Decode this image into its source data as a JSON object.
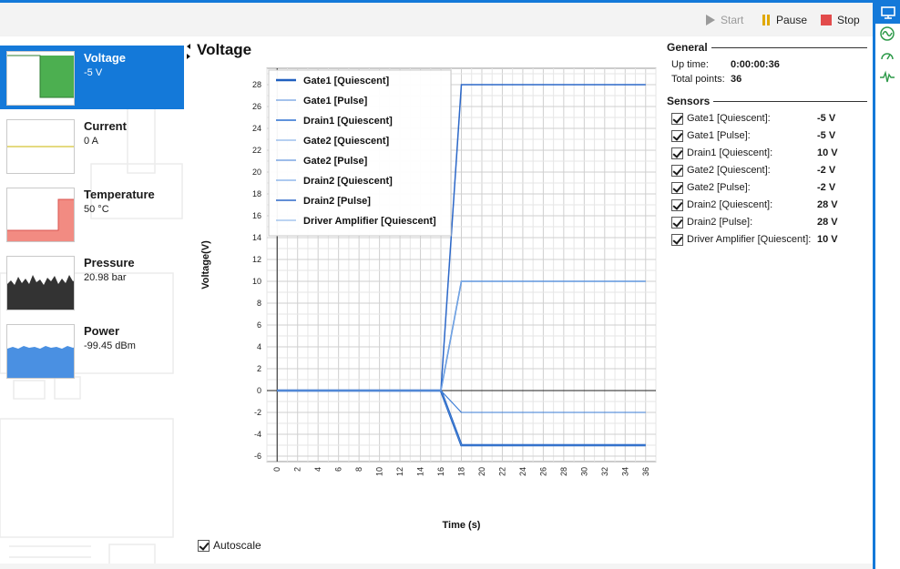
{
  "toolbar": {
    "start_label": "Start",
    "pause_label": "Pause",
    "stop_label": "Stop"
  },
  "sensors": [
    {
      "name": "Voltage",
      "value": "-5 V",
      "active": true,
      "thumb_color": "#4caf50"
    },
    {
      "name": "Current",
      "value": "0 A",
      "active": false,
      "thumb_color": "#c8b400"
    },
    {
      "name": "Temperature",
      "value": "50 °C",
      "active": false,
      "thumb_color": "#f28b82"
    },
    {
      "name": "Pressure",
      "value": "20.98 bar",
      "active": false,
      "thumb_color": "#333333"
    },
    {
      "name": "Power",
      "value": "-99.45 dBm",
      "active": false,
      "thumb_color": "#4a90e2"
    }
  ],
  "chart": {
    "title": "Voltage",
    "autoscale_label": "Autoscale",
    "autoscale_checked": true
  },
  "chart_data": {
    "type": "line",
    "xlabel": "Time (s)",
    "ylabel": "Voltage(V)",
    "xlim": [
      -1,
      37
    ],
    "ylim": [
      -6.5,
      29.5
    ],
    "xticks": [
      0,
      2,
      4,
      6,
      8,
      10,
      12,
      14,
      16,
      18,
      20,
      22,
      24,
      26,
      28,
      30,
      32,
      34,
      36
    ],
    "yticks": [
      -6,
      -4,
      -2,
      0,
      2,
      4,
      6,
      8,
      10,
      12,
      14,
      16,
      18,
      20,
      22,
      24,
      26,
      28
    ],
    "grid": true,
    "legend": "top-left",
    "series": [
      {
        "name": "Gate1 [Quiescent]",
        "color": "#1f5fbf",
        "width": 2.5,
        "x": [
          0,
          16,
          18,
          36
        ],
        "y": [
          0,
          0,
          -5,
          -5
        ]
      },
      {
        "name": "Gate1 [Pulse]",
        "color": "#4a86d8",
        "width": 1,
        "x": [
          0,
          16,
          18,
          36
        ],
        "y": [
          0,
          0,
          -5,
          -5
        ]
      },
      {
        "name": "Drain1 [Quiescent]",
        "color": "#2a6fd0",
        "width": 1.5,
        "x": [
          0,
          16,
          18,
          36
        ],
        "y": [
          0,
          0,
          10,
          10
        ]
      },
      {
        "name": "Gate2 [Quiescent]",
        "color": "#6fa2e4",
        "width": 1,
        "x": [
          0,
          16,
          18,
          36
        ],
        "y": [
          0,
          0,
          -2,
          -2
        ]
      },
      {
        "name": "Gate2 [Pulse]",
        "color": "#3a7bd5",
        "width": 1,
        "x": [
          0,
          16,
          18,
          36
        ],
        "y": [
          0,
          0,
          -2,
          -2
        ]
      },
      {
        "name": "Drain2 [Quiescent]",
        "color": "#5b95e0",
        "width": 1,
        "x": [
          0,
          16,
          18,
          36
        ],
        "y": [
          0,
          0,
          28,
          28
        ]
      },
      {
        "name": "Drain2 [Pulse]",
        "color": "#2d68c8",
        "width": 1.5,
        "x": [
          0,
          16,
          18,
          36
        ],
        "y": [
          0,
          0,
          28,
          28
        ]
      },
      {
        "name": "Driver Amplifier [Quiescent]",
        "color": "#7aaae6",
        "width": 1,
        "x": [
          0,
          16,
          18,
          36
        ],
        "y": [
          0,
          0,
          10,
          10
        ]
      }
    ]
  },
  "general": {
    "title": "General",
    "uptime_label": "Up time:",
    "uptime_value": "0:00:00:36",
    "points_label": "Total points:",
    "points_value": "36"
  },
  "sensors_panel": {
    "title": "Sensors",
    "items": [
      {
        "label": "Gate1 [Quiescent]:",
        "value": "-5 V",
        "checked": true
      },
      {
        "label": "Gate1 [Pulse]:",
        "value": "-5 V",
        "checked": true
      },
      {
        "label": "Drain1 [Quiescent]:",
        "value": "10 V",
        "checked": true
      },
      {
        "label": "Gate2 [Quiescent]:",
        "value": "-2 V",
        "checked": true
      },
      {
        "label": "Gate2 [Pulse]:",
        "value": "-2 V",
        "checked": true
      },
      {
        "label": "Drain2 [Quiescent]:",
        "value": "28 V",
        "checked": true
      },
      {
        "label": "Drain2 [Pulse]:",
        "value": "28 V",
        "checked": true
      },
      {
        "label": "Driver Amplifier [Quiescent]:",
        "value": "10 V",
        "checked": true
      }
    ]
  },
  "rail": {
    "icons": [
      "monitor-icon",
      "waveform-icon",
      "gauge-icon",
      "pulse-icon"
    ],
    "accent": "#1479d9"
  }
}
